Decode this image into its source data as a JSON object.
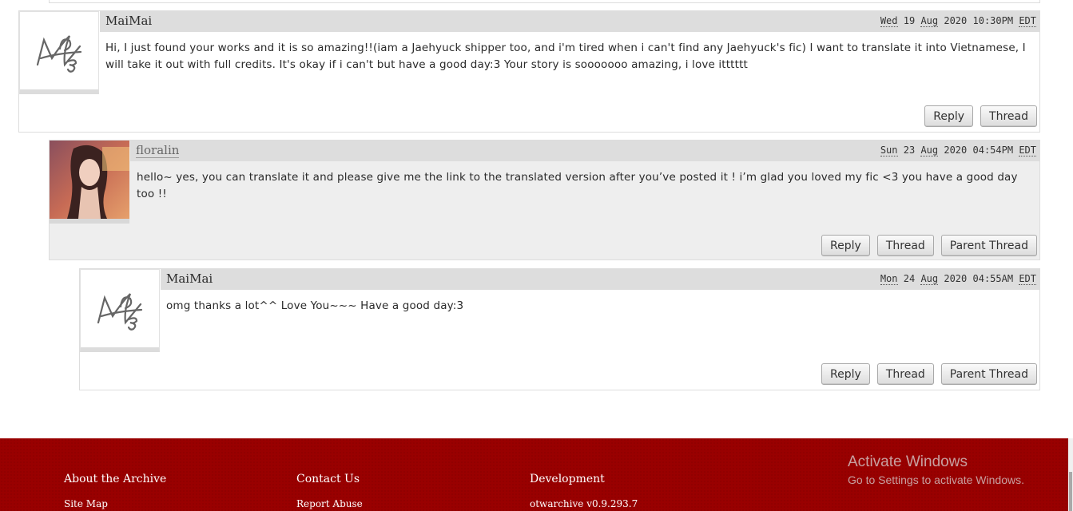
{
  "comments": [
    {
      "author": "MaiMai",
      "weekday": "Wed",
      "date": "19",
      "month": "Aug",
      "year": "2020",
      "time": "10:30PM",
      "tz": "EDT",
      "text": "Hi, I just found your works and it is so amazing!!(iam a Jaehyuck shipper too, and i'm tired when i can't find any Jaehyuck's fic) I want to translate it into Vietnamese, I will take it out with full credits. It's okay if i can't but have a good day:3 Your story is sooooooo amazing, i love itttttt",
      "actions": {
        "reply": "Reply",
        "thread": "Thread"
      }
    },
    {
      "author": "floralin",
      "weekday": "Sun",
      "date": "23",
      "month": "Aug",
      "year": "2020",
      "time": "04:54PM",
      "tz": "EDT",
      "text": "hello~ yes, you can translate it and please give me the link to the translated version after you’ve posted it ! i’m glad you loved my fic <3 you have a good day too !!",
      "actions": {
        "reply": "Reply",
        "thread": "Thread",
        "parent": "Parent Thread"
      }
    },
    {
      "author": "MaiMai",
      "weekday": "Mon",
      "date": "24",
      "month": "Aug",
      "year": "2020",
      "time": "04:55AM",
      "tz": "EDT",
      "text": "omg thanks a lot^^ Love You~~~ Have a good day:3",
      "actions": {
        "reply": "Reply",
        "thread": "Thread",
        "parent": "Parent Thread"
      }
    }
  ],
  "footer": {
    "about": "About the Archive",
    "site_map": "Site Map",
    "contact": "Contact Us",
    "report_abuse": "Report Abuse",
    "development": "Development",
    "version": "otwarchive v0.9.293.7",
    "background_color": "#990000"
  },
  "watermark": {
    "title": "Activate Windows",
    "subtitle": "Go to Settings to activate Windows."
  }
}
